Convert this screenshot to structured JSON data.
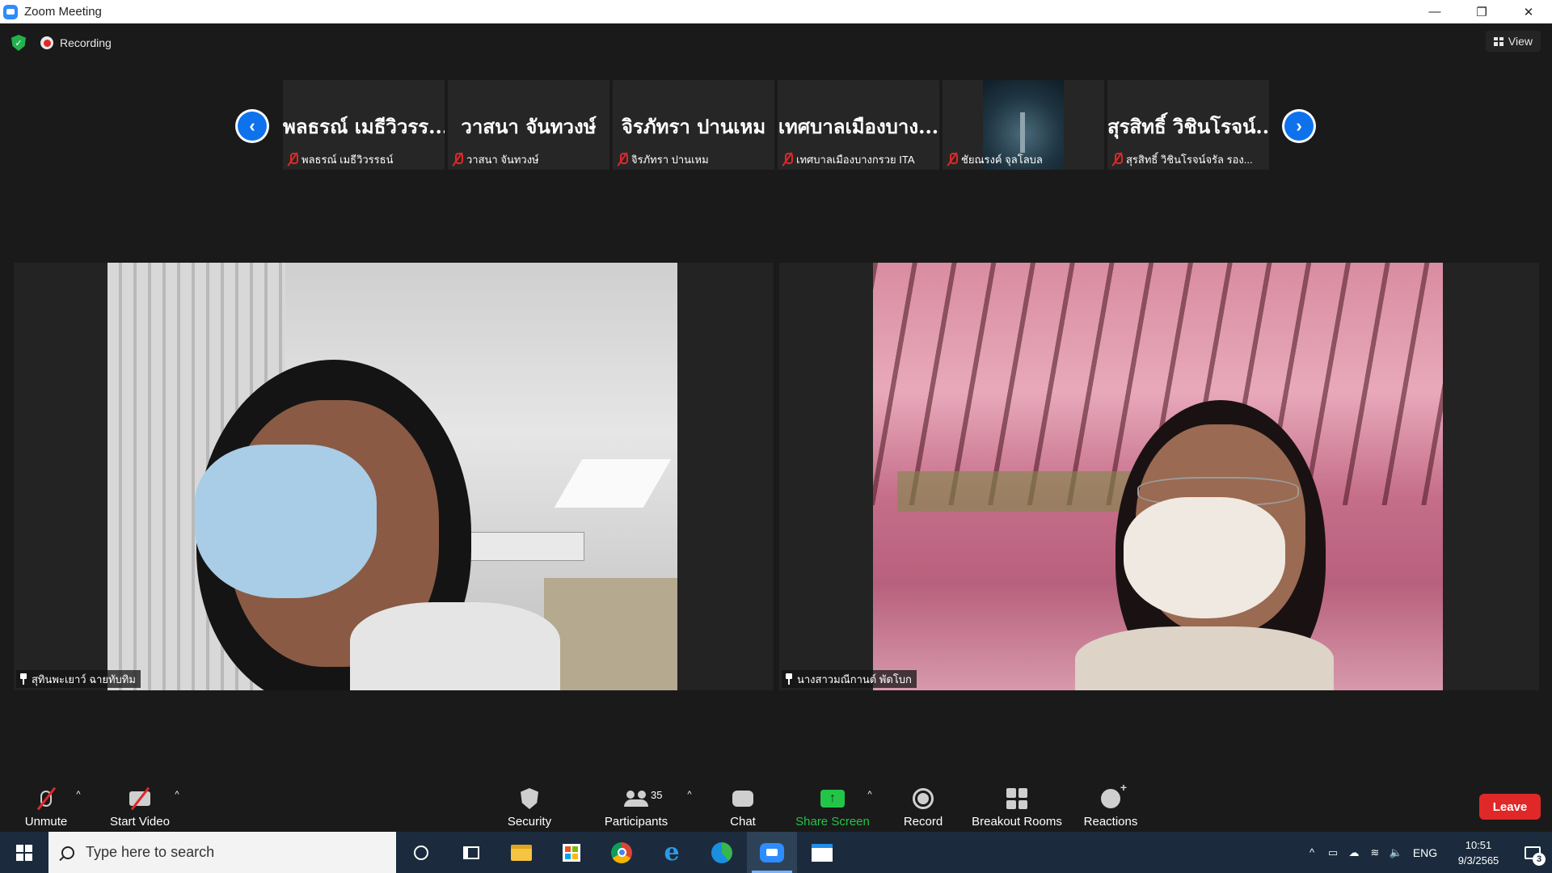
{
  "window": {
    "title": "Zoom Meeting",
    "controls": {
      "minimize": "—",
      "restore": "❐",
      "close": "✕"
    }
  },
  "meeting": {
    "recording_label": "Recording",
    "view_label": "View",
    "strip": {
      "prev_icon": "‹",
      "next_icon": "›",
      "thumbnails": [
        {
          "display_name": "พลธรณ์ เมธีวิวรร...",
          "caption": "พลธรณ์ เมธีวิวรรธน์",
          "muted": true,
          "has_video": false
        },
        {
          "display_name": "วาสนา จันทวงษ์",
          "caption": "วาสนา จันทวงษ์",
          "muted": true,
          "has_video": false
        },
        {
          "display_name": "จิรภัทรา ปานเหม",
          "caption": "จิรภัทรา ปานเหม",
          "muted": true,
          "has_video": false
        },
        {
          "display_name": "เทศบาลเมืองบาง...",
          "caption": "เทศบาลเมืองบางกรวย ITA",
          "muted": true,
          "has_video": false
        },
        {
          "display_name": "",
          "caption": "ชัยณรงค์ จุลโลบล",
          "muted": true,
          "has_video": true
        },
        {
          "display_name": "สุรสิทธิ์ วิชินโรจน์...",
          "caption": "สุรสิทธิ์ วิชินโรจน์จรัล รอง...",
          "muted": true,
          "has_video": false
        }
      ]
    },
    "tiles": [
      {
        "name": "สุทินพะเยาว์ ฉายทับทิม",
        "pinned": true
      },
      {
        "name": "นางสาวมณีกานต์ พัดโบก",
        "pinned": true
      }
    ]
  },
  "toolbar": {
    "unmute_label": "Unmute",
    "start_video_label": "Start Video",
    "security_label": "Security",
    "participants_label": "Participants",
    "participants_count": "35",
    "chat_label": "Chat",
    "share_screen_label": "Share Screen",
    "record_label": "Record",
    "breakout_label": "Breakout Rooms",
    "reactions_label": "Reactions",
    "leave_label": "Leave",
    "caret": "^",
    "share_arrow": "↑"
  },
  "taskbar": {
    "search_placeholder": "Type here to search",
    "ie_glyph": "e",
    "tray": {
      "chevron": "^",
      "battery": "▭",
      "cloud": "☁",
      "wifi": "≋",
      "volume": "🔈",
      "language": "ENG",
      "time": "10:51",
      "date": "9/3/2565",
      "notification_count": "3"
    }
  },
  "colors": {
    "accent_blue": "#0e72ed",
    "leave_red": "#e02828",
    "share_green": "#23c549",
    "muted_red": "#e02828",
    "taskbar": "#1b2b3d"
  }
}
